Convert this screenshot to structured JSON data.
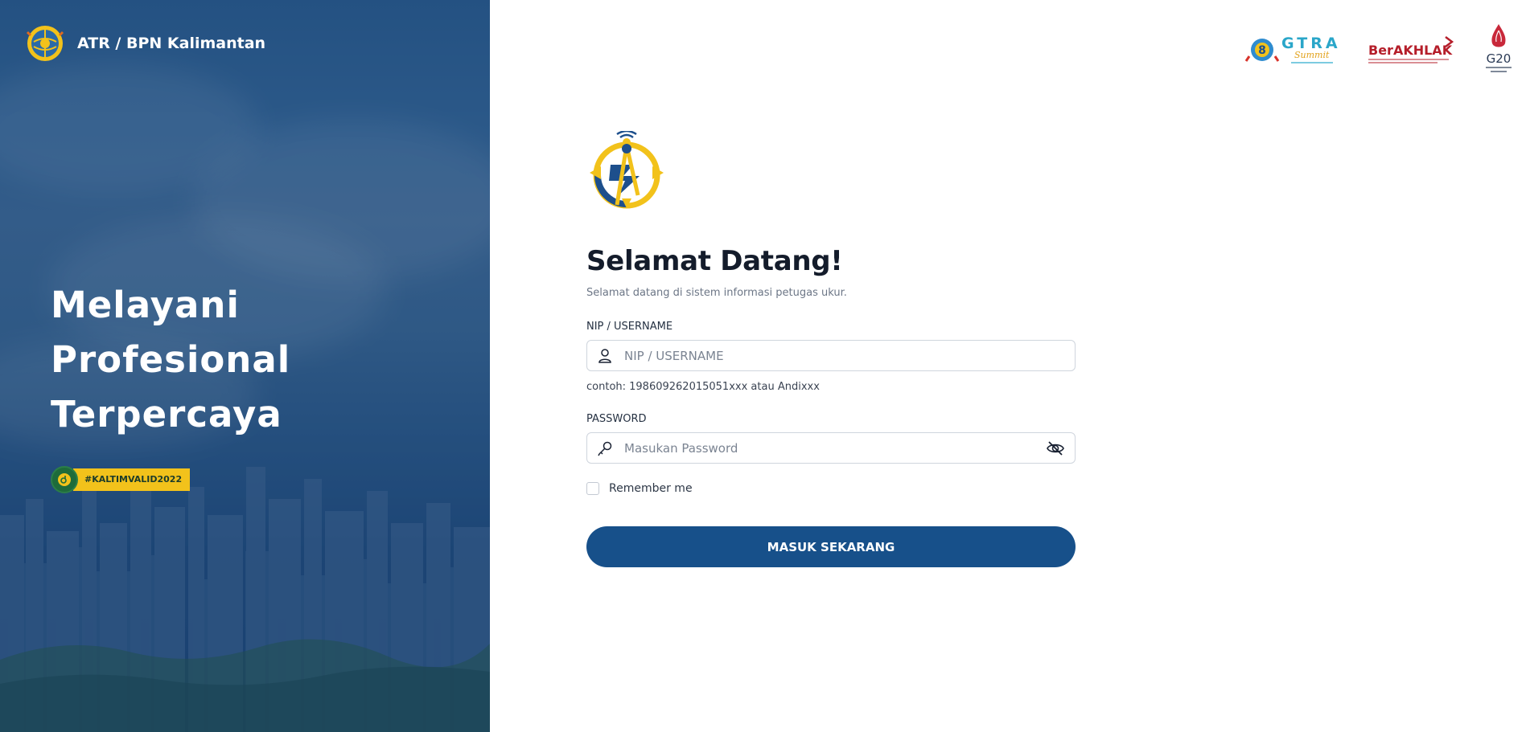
{
  "brand": {
    "title": "ATR / BPN Kalimantan",
    "logo_icon": "atr-bpn-globe-logo"
  },
  "hero": {
    "tagline_lines": [
      "Melayani",
      "Profesional",
      "Terpercaya"
    ],
    "hashtag": "#KALTIMVALID2022"
  },
  "partners": [
    "GTRA Summit Wakatobi 2022",
    "BerAKHLAK",
    "G20 Indonesia 2022"
  ],
  "login": {
    "app_logo_icon": "surveyor-compass-logo",
    "title": "Selamat Datang!",
    "subtitle": "Selamat datang di sistem informasi petugas ukur.",
    "username_label": "NIP / USERNAME",
    "username_placeholder": "NIP / USERNAME",
    "username_hint": "contoh: 19860926201505​1xxx atau Andixxx",
    "password_label": "PASSWORD",
    "password_placeholder": "Masukan Password",
    "remember_label": "Remember me",
    "submit_label": "MASUK SEKARANG"
  },
  "colors": {
    "primary": "#17508a",
    "hero_overlay": "#1f4674",
    "hashtag_bg": "#f2c21b",
    "logo_yellow": "#f2c21b",
    "logo_blue": "#1d4f8c"
  }
}
